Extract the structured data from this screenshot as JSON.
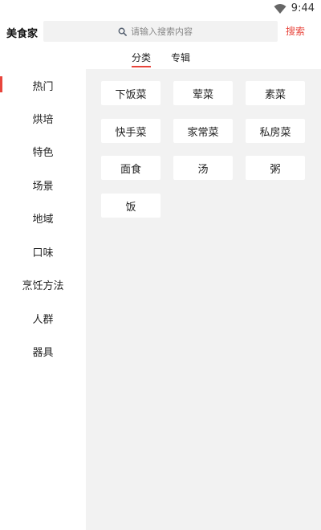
{
  "status_bar": {
    "time": "9:44",
    "icons": [
      "wifi-icon"
    ]
  },
  "header": {
    "app_name": "美食家",
    "search_placeholder": "请输入搜索内容",
    "search_button": "搜索",
    "search_icon": "search-icon"
  },
  "tabs": [
    {
      "label": "分类",
      "active": true
    },
    {
      "label": "专辑",
      "active": false
    }
  ],
  "sidebar": {
    "items": [
      {
        "label": "热门",
        "active": true
      },
      {
        "label": "烘培"
      },
      {
        "label": "特色"
      },
      {
        "label": "场景"
      },
      {
        "label": "地域"
      },
      {
        "label": "口味"
      },
      {
        "label": "烹饪方法"
      },
      {
        "label": "人群"
      },
      {
        "label": "器具"
      }
    ]
  },
  "content": {
    "tags": [
      "下饭菜",
      "荤菜",
      "素菜",
      "快手菜",
      "家常菜",
      "私房菜",
      "面食",
      "汤",
      "粥",
      "饭"
    ]
  },
  "colors": {
    "accent": "#e8453c",
    "panel_bg": "#f2f2f2",
    "search_bg": "#f2f2f2"
  }
}
